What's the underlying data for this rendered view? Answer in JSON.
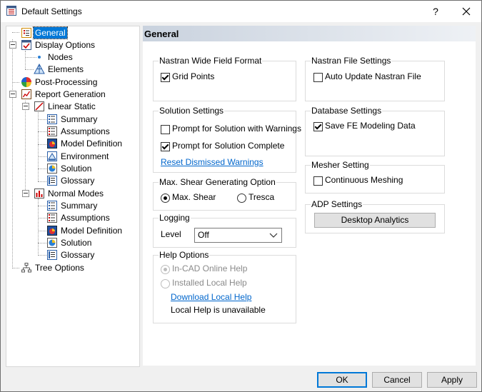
{
  "window": {
    "title": "Default Settings",
    "help": "?"
  },
  "tree": {
    "general": "General",
    "display_options": "Display Options",
    "nodes": "Nodes",
    "elements": "Elements",
    "post_processing": "Post-Processing",
    "report_generation": "Report Generation",
    "linear_static": {
      "label": "Linear Static",
      "summary": "Summary",
      "assumptions": "Assumptions",
      "model_definition": "Model Definition",
      "environment": "Environment",
      "solution": "Solution",
      "glossary": "Glossary"
    },
    "normal_modes": {
      "label": "Normal Modes",
      "summary": "Summary",
      "assumptions": "Assumptions",
      "model_definition": "Model Definition",
      "solution": "Solution",
      "glossary": "Glossary"
    },
    "tree_options": "Tree Options"
  },
  "panel": {
    "title": "General",
    "nastran_wide": {
      "title": "Nastran Wide Field Format",
      "grid_points": "Grid Points",
      "grid_points_checked": true
    },
    "solution_settings": {
      "title": "Solution Settings",
      "prompt_warnings": "Prompt for Solution with Warnings",
      "prompt_warnings_checked": false,
      "prompt_complete": "Prompt for Solution Complete",
      "prompt_complete_checked": true,
      "reset_link": "Reset Dismissed Warnings"
    },
    "max_shear": {
      "title": "Max. Shear Generating Option",
      "opt1": "Max. Shear",
      "opt2": "Tresca",
      "selected": "Max. Shear"
    },
    "logging": {
      "title": "Logging",
      "level_label": "Level",
      "level_value": "Off"
    },
    "help_options": {
      "title": "Help Options",
      "online": "In-CAD Online Help",
      "local": "Installed Local Help",
      "download_link": "Download Local Help",
      "status": "Local Help is unavailable"
    },
    "nastran_file": {
      "title": "Nastran File Settings",
      "auto_update": "Auto Update Nastran File",
      "auto_update_checked": false
    },
    "database": {
      "title": "Database Settings",
      "save_fe": "Save FE Modeling Data",
      "save_fe_checked": true
    },
    "mesher": {
      "title": "Mesher Setting",
      "continuous": "Continuous Meshing",
      "continuous_checked": false
    },
    "adp": {
      "title": "ADP Settings",
      "button": "Desktop Analytics"
    }
  },
  "buttons": {
    "ok": "OK",
    "cancel": "Cancel",
    "apply": "Apply"
  },
  "colors": {
    "selection": "#0078d7",
    "link": "#0066cc",
    "header_gradient_start": "#c9d2de"
  }
}
